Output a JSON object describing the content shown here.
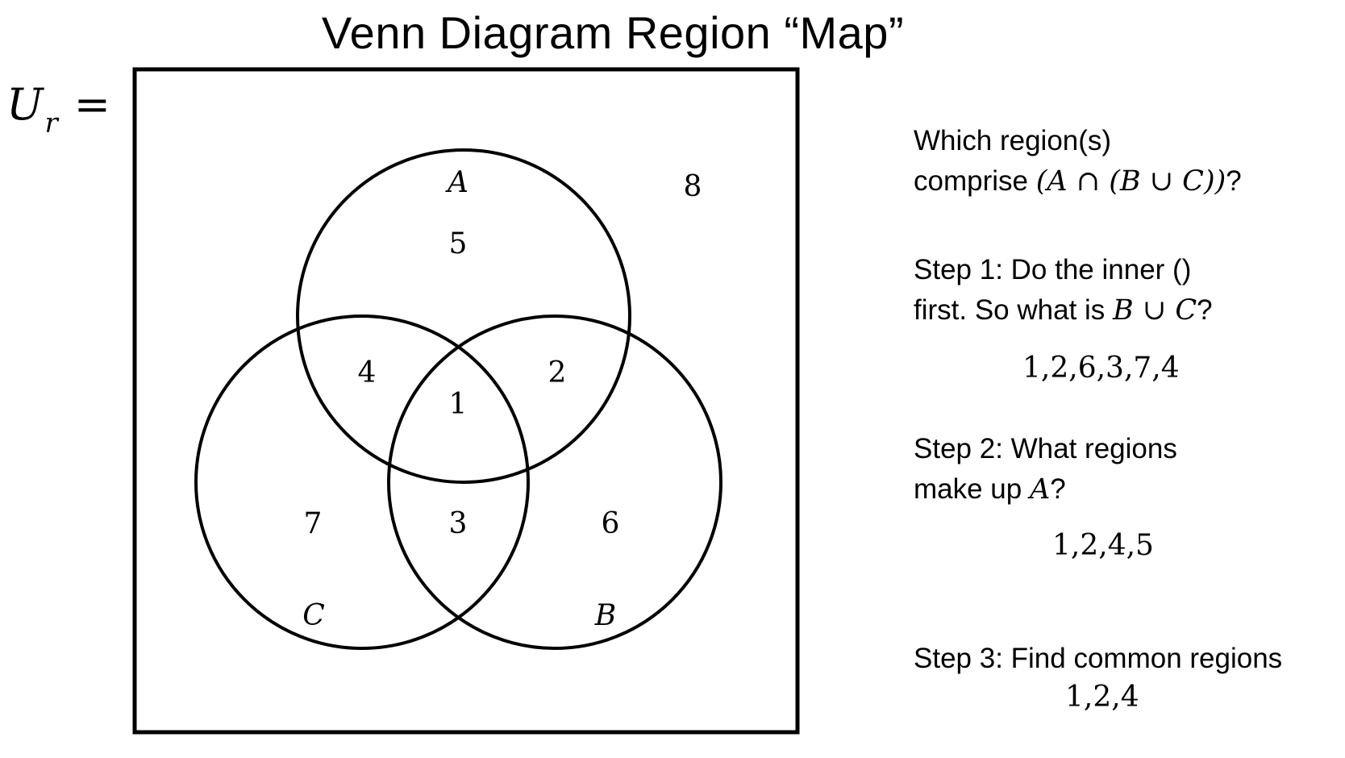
{
  "title": "Venn Diagram Region “Map”",
  "universe_label": {
    "symbol": "U",
    "subscript": "r",
    "equals": "="
  },
  "diagram": {
    "sets": {
      "A": "A",
      "B": "B",
      "C": "C"
    },
    "regions": [
      "1",
      "2",
      "3",
      "4",
      "5",
      "6",
      "7",
      "8"
    ]
  },
  "question": {
    "line1": "Which region(s)",
    "line2_text": "comprise",
    "line2_math": "(A ∩ (B ∪ C))",
    "line2_end": "?"
  },
  "step1": {
    "line1": "Step 1: Do the inner ()",
    "line2_text": "first. So what is",
    "line2_math": "B ∪ C",
    "line2_end": "?",
    "answer": "1,2,6,3,7,4"
  },
  "step2": {
    "line1": "Step 2: What regions",
    "line2_text": "make up",
    "line2_math": "A",
    "line2_end": "?",
    "answer": "1,2,4,5"
  },
  "step3": {
    "line1": "Step 3: Find common regions",
    "answer": "1,2,4"
  }
}
